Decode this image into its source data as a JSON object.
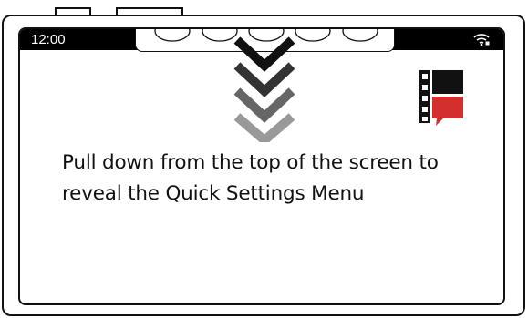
{
  "status_bar": {
    "time": "12:00",
    "wifi_icon": "wifi-icon",
    "background": "#000000"
  },
  "logo": {
    "icon": "film-chat-logo-icon",
    "accent_color": "#d32f2f"
  },
  "swipe_hint": {
    "icon": "chevron-down-icon",
    "direction": "down",
    "colors": [
      "#111111",
      "#333333",
      "#666666",
      "#999999"
    ]
  },
  "instruction": {
    "text": "Pull down from the top of the screen to reveal the Quick Settings Menu"
  }
}
